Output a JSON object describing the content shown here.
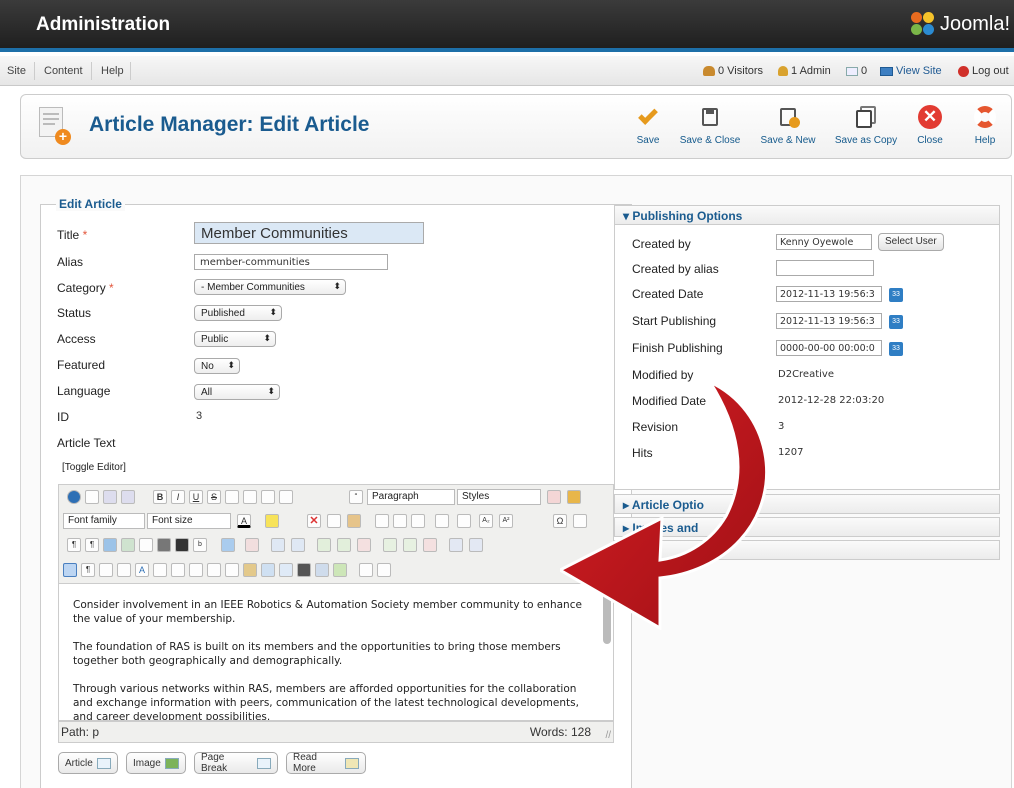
{
  "header": {
    "title": "Administration",
    "brand": "Joomla!"
  },
  "menu": {
    "items": [
      "Site",
      "Content",
      "Help"
    ]
  },
  "status": {
    "visitors": "0 Visitors",
    "admins": "1 Admin",
    "messages": "0",
    "view_site": "View Site",
    "logout": "Log out"
  },
  "toolbar": {
    "page_title": "Article Manager: Edit Article",
    "buttons": [
      "Save",
      "Save & Close",
      "Save & New",
      "Save as Copy",
      "Close",
      "Help"
    ]
  },
  "edit": {
    "legend": "Edit Article",
    "title_label": "Title",
    "title_value": "Member Communities",
    "alias_label": "Alias",
    "alias_value": "member-communities",
    "category_label": "Category",
    "category_value": "- Member Communities",
    "status_label": "Status",
    "status_value": "Published",
    "access_label": "Access",
    "access_value": "Public",
    "featured_label": "Featured",
    "featured_value": "No",
    "language_label": "Language",
    "language_value": "All",
    "id_label": "ID",
    "id_value": "3",
    "article_text_label": "Article Text",
    "toggle_editor": "[Toggle Editor]"
  },
  "editor": {
    "paragraph_select": "Paragraph",
    "styles_select": "Styles",
    "font_family": "Font family",
    "font_size": "Font size",
    "body": [
      "Consider involvement in an IEEE Robotics & Automation Society member community to enhance the value of your membership.",
      "The foundation of RAS is built on its members and the opportunities to bring those members together both geographically and demographically.",
      "Through various networks within RAS, members are afforded opportunities for the collaboration and exchange information with peers, communication of the latest technological developments, and career development possibilities."
    ],
    "path": "Path: p",
    "words": "Words: 128"
  },
  "insert_buttons": [
    "Article",
    "Image",
    "Page Break",
    "Read More"
  ],
  "publishing": {
    "heading": "Publishing Options",
    "created_by_label": "Created by",
    "created_by_value": "Kenny Oyewole",
    "select_user": "Select User",
    "created_by_alias_label": "Created by alias",
    "created_date_label": "Created Date",
    "created_date_value": "2012-11-13 19:56:3",
    "start_publishing_label": "Start Publishing",
    "start_publishing_value": "2012-11-13 19:56:3",
    "finish_publishing_label": "Finish Publishing",
    "finish_publishing_value": "0000-00-00 00:00:0",
    "modified_by_label": "Modified by",
    "modified_by_value": "D2Creative",
    "modified_date_label": "Modified Date",
    "modified_date_value": "2012-12-28 22:03:20",
    "revision_label": "Revision",
    "revision_value": "3",
    "hits_label": "Hits",
    "hits_value": "1207",
    "calendar_label": "33"
  },
  "accordion": [
    "Article Optio",
    "Images and",
    "M"
  ],
  "colors": {
    "accent": "#1a5b8f",
    "topbar": "#2a2a2a",
    "arrow": "#c4161c"
  }
}
